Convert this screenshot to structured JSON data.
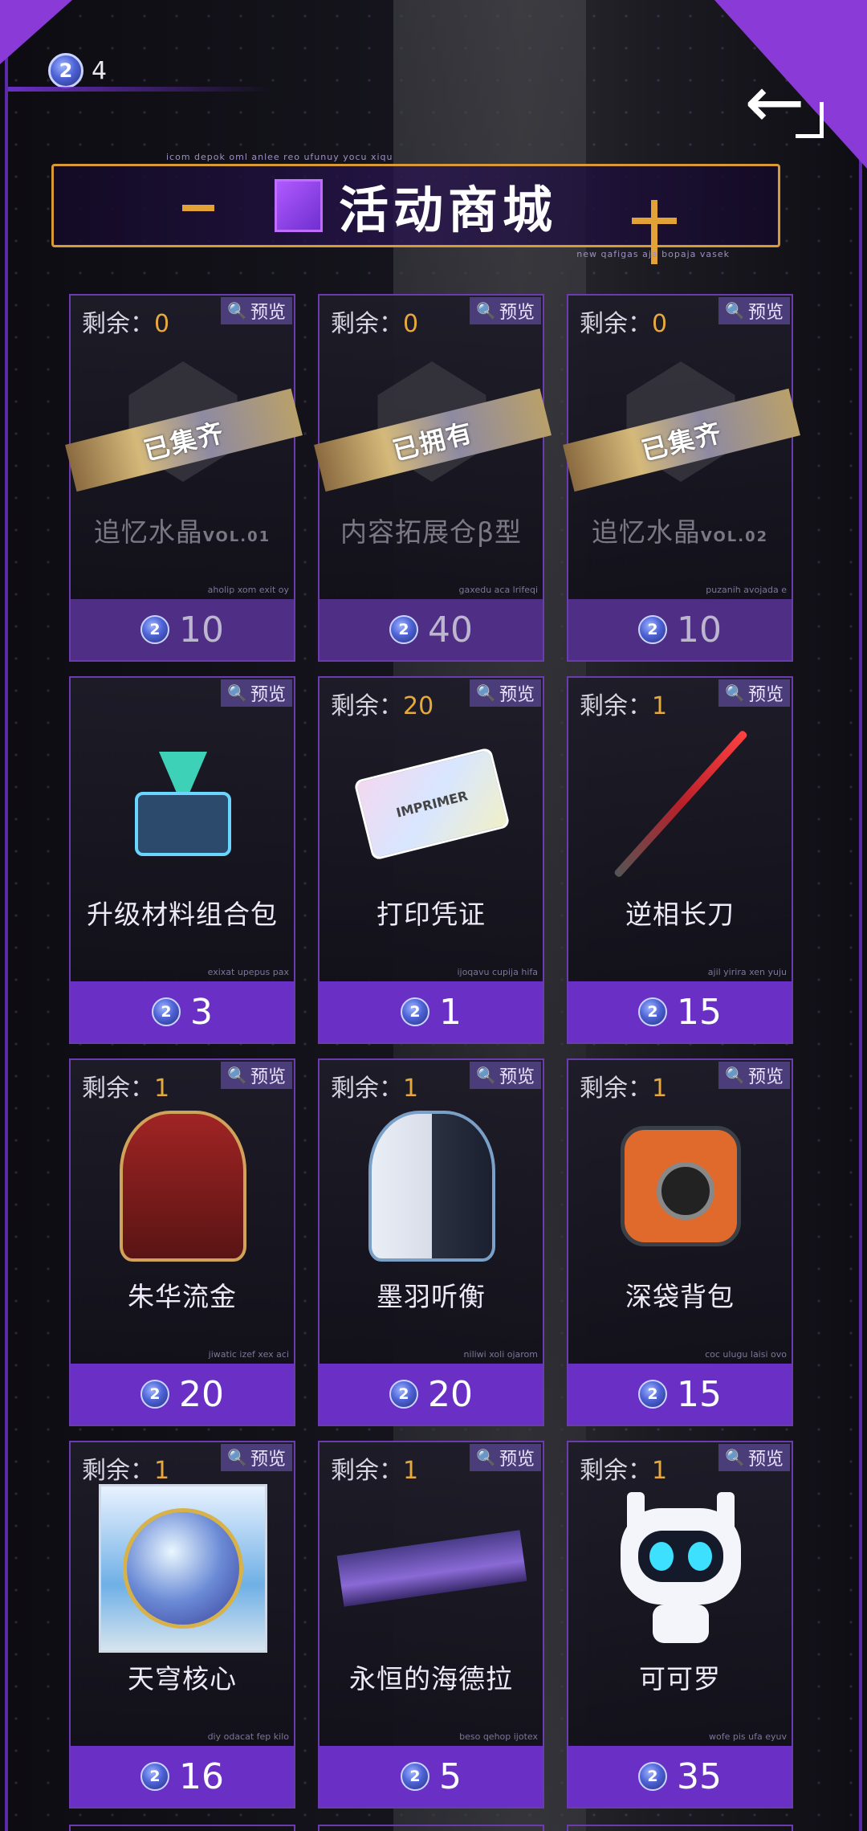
{
  "header": {
    "currency_amount": "4",
    "currency_icon": "event-coin-icon",
    "back_icon": "back-arrow-icon"
  },
  "title": {
    "text": "活动商城",
    "tiny_top": "icom depok oml anlee reo ufunuy yocu xiqu",
    "tiny_bottom": "new qafigas aja bopaja vasek"
  },
  "labels": {
    "stock_prefix": "剩余：",
    "preview": "预览"
  },
  "colors": {
    "accent": "#6a2fc4",
    "stock_number": "#e7a83c",
    "frame": "#d79a34"
  },
  "items": [
    {
      "stock": "0",
      "name": "追忆水晶",
      "suffix": "VOL.01",
      "price": "10",
      "ribbon": "已集齐",
      "tag": "aholip xom exit oy"
    },
    {
      "stock": "0",
      "name": "内容拓展仓β型",
      "suffix": "",
      "price": "40",
      "ribbon": "已拥有",
      "tag": "gaxedu aca lrifeqi"
    },
    {
      "stock": "0",
      "name": "追忆水晶",
      "suffix": "VOL.02",
      "price": "10",
      "ribbon": "已集齐",
      "tag": "puzanih avojada e"
    },
    {
      "stock": "",
      "name": "升级材料组合包",
      "suffix": "",
      "price": "3",
      "ribbon": "",
      "tag": "exixat upepus pax"
    },
    {
      "stock": "20",
      "name": "打印凭证",
      "suffix": "",
      "price": "1",
      "ribbon": "",
      "tag": "ijoqavu cupija hifa"
    },
    {
      "stock": "1",
      "name": "逆相长刀",
      "suffix": "",
      "price": "15",
      "ribbon": "",
      "tag": "ajil yirira xen yuju"
    },
    {
      "stock": "1",
      "name": "朱华流金",
      "suffix": "",
      "price": "20",
      "ribbon": "",
      "tag": "jiwatic izef xex aci"
    },
    {
      "stock": "1",
      "name": "墨羽听衡",
      "suffix": "",
      "price": "20",
      "ribbon": "",
      "tag": "niliwi xoli ojarom"
    },
    {
      "stock": "1",
      "name": "深袋背包",
      "suffix": "",
      "price": "15",
      "ribbon": "",
      "tag": "coc ulugu laisi ovo"
    },
    {
      "stock": "1",
      "name": "天穹核心",
      "suffix": "",
      "price": "16",
      "ribbon": "",
      "tag": "diy odacat fep kilo"
    },
    {
      "stock": "1",
      "name": "永恒的海德拉",
      "suffix": "",
      "price": "5",
      "ribbon": "",
      "tag": "beso qehop ijotex"
    },
    {
      "stock": "1",
      "name": "可可罗",
      "suffix": "",
      "price": "35",
      "ribbon": "",
      "tag": "wofe pis ufa eyuv"
    }
  ],
  "ticket_text": "IMPRIMER"
}
